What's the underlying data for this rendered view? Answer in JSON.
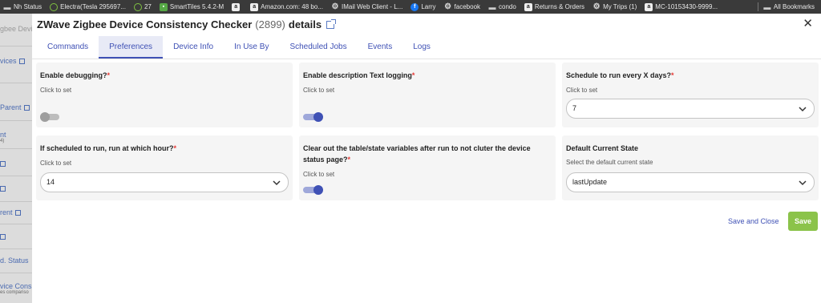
{
  "bookmarks": [
    {
      "label": "Nh Status",
      "icon": "folder-icon"
    },
    {
      "label": "Electra(Tesla 295697...",
      "icon": "hubitat-icon"
    },
    {
      "label": "27",
      "icon": "hubitat-icon"
    },
    {
      "label": "SmartTiles 5.4.2-M",
      "icon": "smarttiles-icon"
    },
    {
      "label": "",
      "icon": "amazon-icon"
    },
    {
      "label": "Amazon.com: 48 bo...",
      "icon": "amazon-icon"
    },
    {
      "label": "IMail Web Client - L...",
      "icon": "gear-icon"
    },
    {
      "label": "Larry",
      "icon": "facebook-icon"
    },
    {
      "label": "facebook",
      "icon": "gear-icon"
    },
    {
      "label": "condo",
      "icon": "folder-icon"
    },
    {
      "label": "Returns & Orders",
      "icon": "amazon-icon"
    },
    {
      "label": "My Trips (1)",
      "icon": "gear-icon"
    },
    {
      "label": "MC-10153430-9999...",
      "icon": "amazon-icon"
    }
  ],
  "all_bookmarks": "All Bookmarks",
  "underlay": {
    "items": [
      "gbee Devi",
      "vices",
      "Parent",
      "nt",
      "4)",
      "",
      "",
      "rent",
      "",
      "d. Status",
      "vice Consi",
      "es compariso"
    ]
  },
  "modal": {
    "title": "ZWave Zigbee Device Consistency Checker",
    "count": "(2899)",
    "details": "details",
    "close": "✕"
  },
  "tabs": [
    "Commands",
    "Preferences",
    "Device Info",
    "In Use By",
    "Scheduled Jobs",
    "Events",
    "Logs"
  ],
  "active_tab": "Preferences",
  "preferences": {
    "debug": {
      "label": "Enable debugging?",
      "required": "*",
      "hint": "Click to set",
      "state": "off"
    },
    "desc_logging": {
      "label": "Enable description Text logging",
      "required": "*",
      "hint": "Click to set",
      "state": "on"
    },
    "schedule_days": {
      "label": "Schedule to run every X days?",
      "required": "*",
      "hint": "Click to set",
      "value": "7"
    },
    "run_hour": {
      "label": "If scheduled to run, run at which hour?",
      "required": "*",
      "hint": "Click to set",
      "value": "14"
    },
    "clear_table": {
      "label": "Clear out the table/state variables after run to not cluter the device status page?",
      "required": "*",
      "hint": "Click to set",
      "state": "on"
    },
    "current_state": {
      "label": "Default Current State",
      "hint": "Select the default current state",
      "value": "lastUpdate"
    }
  },
  "buttons": {
    "save_close": "Save and Close",
    "save": "Save"
  },
  "colors": {
    "accent": "#3f51b5",
    "save": "#8bc34a",
    "required": "#e53935"
  }
}
